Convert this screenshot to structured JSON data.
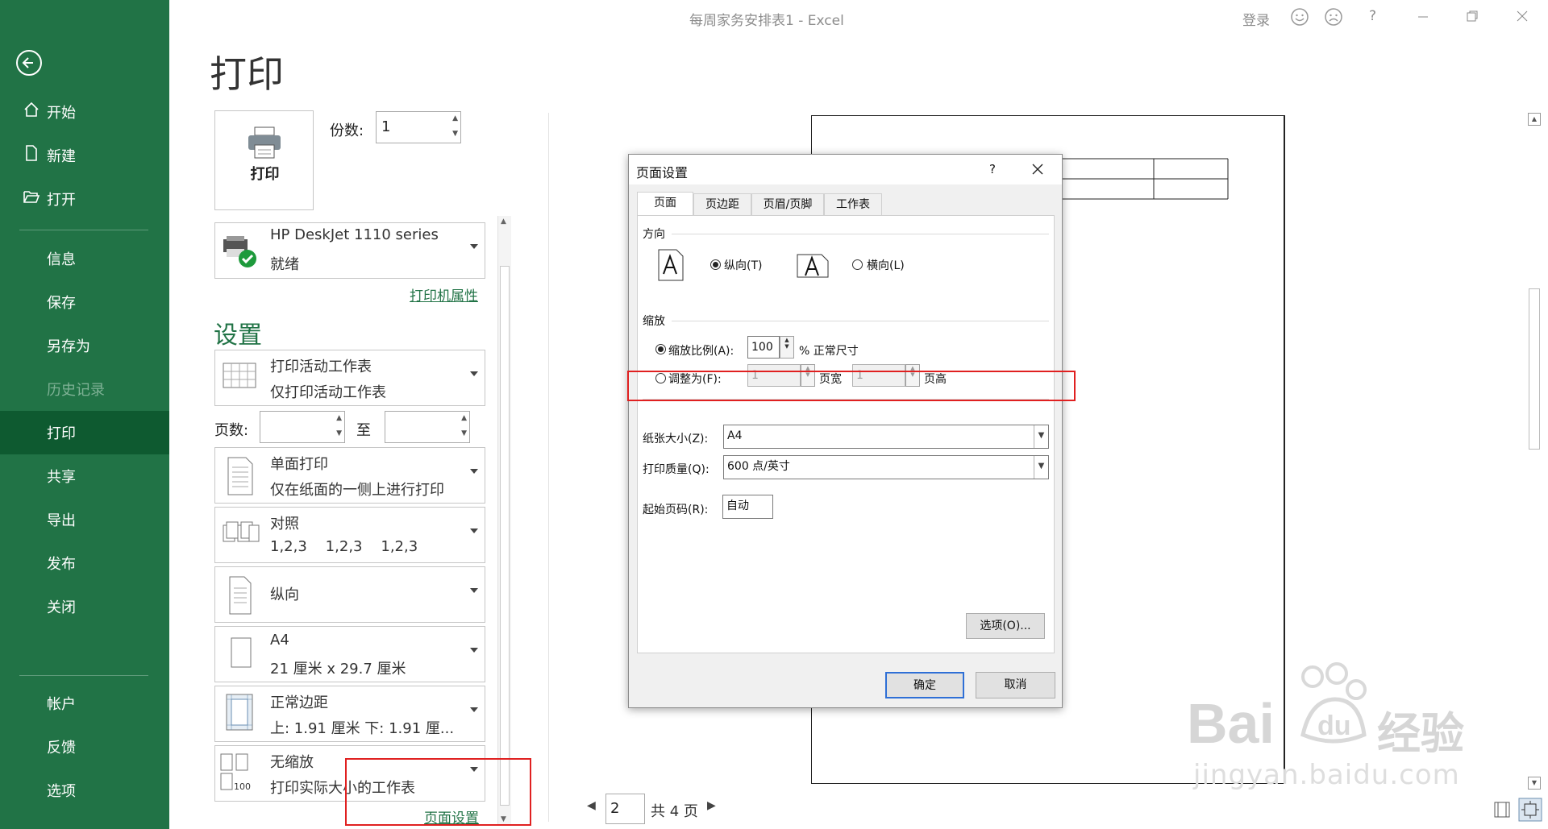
{
  "window": {
    "title": "每周家务安排表1  -  Excel",
    "signin": "登录",
    "help": "?"
  },
  "sidebar": {
    "items": [
      {
        "label": "开始",
        "icon": "home-icon"
      },
      {
        "label": "新建",
        "icon": "new-doc-icon"
      },
      {
        "label": "打开",
        "icon": "folder-open-icon"
      },
      {
        "label": "信息"
      },
      {
        "label": "保存"
      },
      {
        "label": "另存为"
      },
      {
        "label": "历史记录"
      },
      {
        "label": "打印"
      },
      {
        "label": "共享"
      },
      {
        "label": "导出"
      },
      {
        "label": "发布"
      },
      {
        "label": "关闭"
      },
      {
        "label": "帐户"
      },
      {
        "label": "反馈"
      },
      {
        "label": "选项"
      }
    ]
  },
  "print": {
    "title": "打印",
    "print_button": "打印",
    "copies_label": "份数:",
    "copies_value": "1",
    "printer_name": "HP DeskJet 1110 series",
    "printer_status": "就绪",
    "printer_props": "打印机属性",
    "settings_title": "设置",
    "settings": [
      {
        "l1": "打印活动工作表",
        "l2": "仅打印活动工作表"
      },
      {
        "l1": "单面打印",
        "l2": "仅在纸面的一侧上进行打印"
      },
      {
        "l1": "对照",
        "l2": "1,2,3    1,2,3    1,2,3"
      },
      {
        "l1": "纵向",
        "l2": ""
      },
      {
        "l1": "A4",
        "l2": "21 厘米 x 29.7 厘米"
      },
      {
        "l1": "正常边距",
        "l2": "上: 1.91 厘米 下: 1.91 厘..."
      },
      {
        "l1": "无缩放",
        "l2": "打印实际大小的工作表"
      }
    ],
    "pages_label": "页数:",
    "pages_to": "至",
    "page_setup_link": "页面设置",
    "scale_icon_text": "100"
  },
  "preview": {
    "page": "2",
    "total": "共 4 页"
  },
  "dialog": {
    "title": "页面设置",
    "help": "?",
    "tabs": [
      "页面",
      "页边距",
      "页眉/页脚",
      "工作表"
    ],
    "orientation_label": "方向",
    "portrait": "纵向(T)",
    "landscape": "横向(L)",
    "scaling_label": "缩放",
    "adjust_label": "缩放比例(A):",
    "adjust_value": "100",
    "percent_label": "% 正常尺寸",
    "fit_label": "调整为(F):",
    "fit_wide_value": "1",
    "fit_wide_label": "页宽",
    "fit_tall_value": "1",
    "fit_tall_label": "页高",
    "paper_size_label": "纸张大小(Z):",
    "paper_size_value": "A4",
    "quality_label": "打印质量(Q):",
    "quality_value": "600 点/英寸",
    "first_page_label": "起始页码(R):",
    "first_page_value": "自动",
    "options_button": "选项(O)...",
    "ok_button": "确定",
    "cancel_button": "取消"
  },
  "watermark": {
    "brand": "Bai",
    "brand_cn": "经验",
    "url": "jingyan.baidu.com"
  }
}
